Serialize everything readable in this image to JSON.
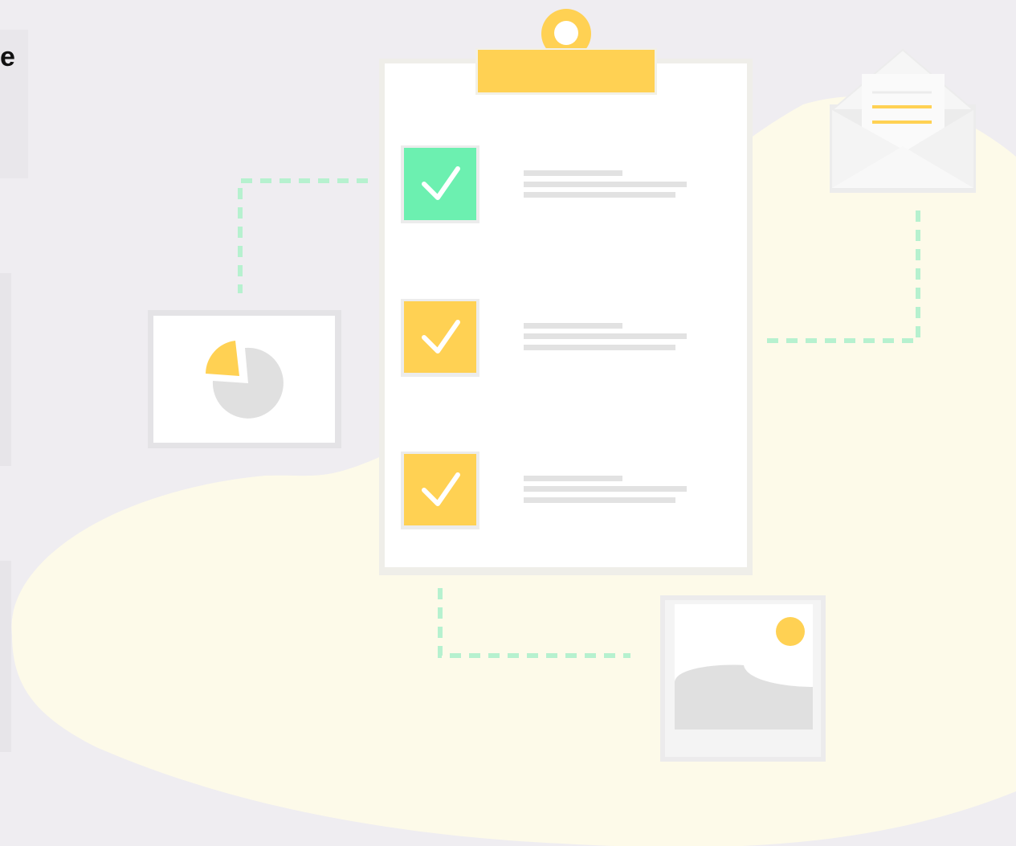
{
  "left_panel": {
    "heading_fragment": "e"
  },
  "icons": {
    "clipboard": "clipboard-icon",
    "checkbox_checked": "check-icon",
    "pie_chart": "pie-chart-icon",
    "envelope": "envelope-icon",
    "image": "image-icon"
  },
  "checklist": {
    "items": [
      {
        "state": "checked",
        "color": "#6cf0b0"
      },
      {
        "state": "checked",
        "color": "#ffd153"
      },
      {
        "state": "checked",
        "color": "#ffd153"
      }
    ]
  },
  "colors": {
    "background": "#efedf1",
    "blob": "#fdfae9",
    "accent_yellow": "#ffd153",
    "accent_green": "#6cf0b0",
    "dash_green": "#b6f1cf",
    "paper": "#ffffff",
    "placeholder_gray": "#e0e0e0"
  }
}
